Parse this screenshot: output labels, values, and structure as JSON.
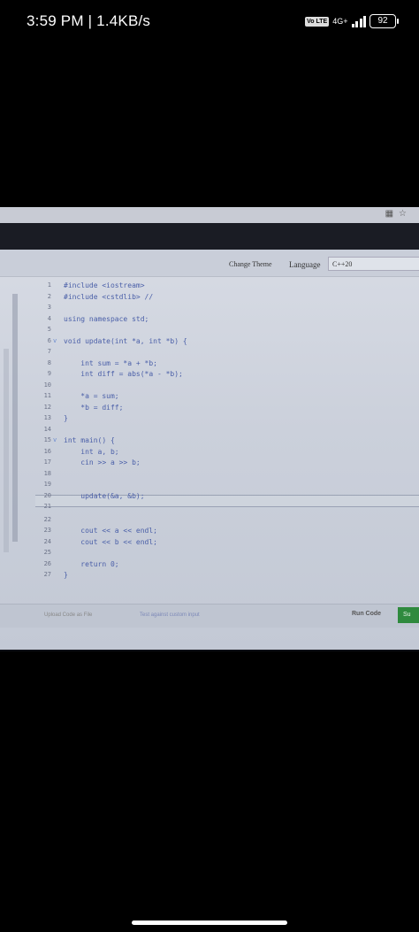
{
  "status_bar": {
    "time_speed": "3:59 PM | 1.4KB/s",
    "volte": "Vo LTE",
    "network": "4G+",
    "battery": "92"
  },
  "editor": {
    "change_theme": "Change Theme",
    "language_label": "Language",
    "language_value": "C++20",
    "lines": [
      {
        "n": "1",
        "text": "#include <iostream>",
        "fold": ""
      },
      {
        "n": "2",
        "text": "#include <cstdlib> //",
        "fold": ""
      },
      {
        "n": "3",
        "text": "",
        "fold": ""
      },
      {
        "n": "4",
        "text": "using namespace std;",
        "fold": ""
      },
      {
        "n": "5",
        "text": "",
        "fold": ""
      },
      {
        "n": "6",
        "text": "void update(int *a, int *b) {",
        "fold": "v"
      },
      {
        "n": "7",
        "text": "",
        "fold": ""
      },
      {
        "n": "8",
        "text": "    int sum = *a + *b;",
        "fold": ""
      },
      {
        "n": "9",
        "text": "    int diff = abs(*a - *b);",
        "fold": ""
      },
      {
        "n": "10",
        "text": "",
        "fold": ""
      },
      {
        "n": "11",
        "text": "    *a = sum;",
        "fold": ""
      },
      {
        "n": "12",
        "text": "    *b = diff;",
        "fold": ""
      },
      {
        "n": "13",
        "text": "}",
        "fold": ""
      },
      {
        "n": "14",
        "text": "",
        "fold": ""
      },
      {
        "n": "15",
        "text": "int main() {",
        "fold": "v"
      },
      {
        "n": "16",
        "text": "    int a, b;",
        "fold": ""
      },
      {
        "n": "17",
        "text": "    cin >> a >> b;",
        "fold": ""
      },
      {
        "n": "18",
        "text": "",
        "fold": ""
      },
      {
        "n": "19",
        "text": "",
        "fold": ""
      },
      {
        "n": "20",
        "text": "    update(&a, &b);",
        "fold": ""
      },
      {
        "n": "21",
        "text": "",
        "fold": ""
      },
      {
        "n": "22",
        "text": "",
        "fold": ""
      },
      {
        "n": "23",
        "text": "    cout << a << endl;",
        "fold": ""
      },
      {
        "n": "24",
        "text": "    cout << b << endl;",
        "fold": ""
      },
      {
        "n": "25",
        "text": "",
        "fold": ""
      },
      {
        "n": "26",
        "text": "    return 0;",
        "fold": ""
      },
      {
        "n": "27",
        "text": "}",
        "fold": ""
      }
    ],
    "upload_label": "Upload Code as File",
    "custom_input_label": "Test against custom input",
    "run_label": "Run Code",
    "submit_label": "Su"
  }
}
